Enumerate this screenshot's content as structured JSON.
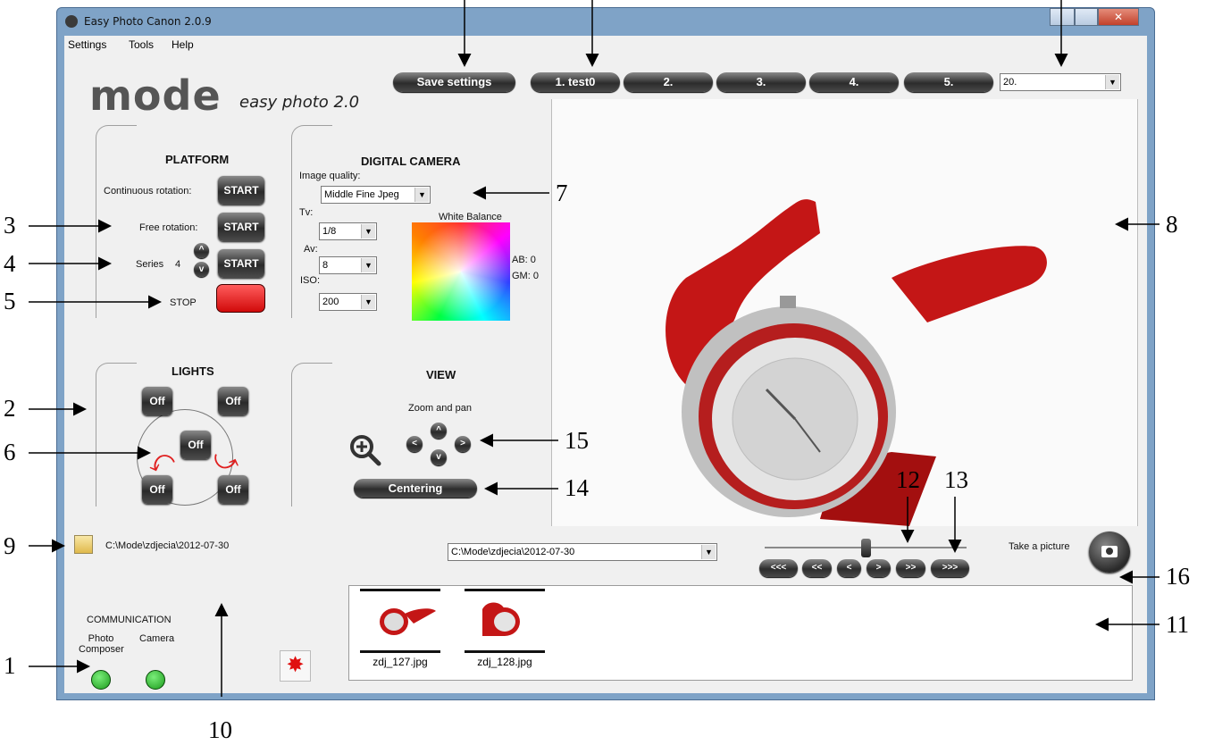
{
  "window": {
    "title": "Easy Photo Canon 2.0.9"
  },
  "menu": {
    "items": [
      "Settings",
      "Tools",
      "Help"
    ]
  },
  "logo": {
    "brand": "mode",
    "tagline": "easy photo 2.0"
  },
  "toolbar": {
    "save_label": "Save settings",
    "presets": [
      "1. test0",
      "2.",
      "3.",
      "4.",
      "5."
    ],
    "preset_select": "20."
  },
  "platform": {
    "title": "PLATFORM",
    "continuous_label": "Continuous rotation:",
    "free_label": "Free rotation:",
    "series_label": "Series",
    "series_value": "4",
    "start_label": "START",
    "stop_label": "STOP",
    "up_label": "^",
    "down_label": "v"
  },
  "camera": {
    "title": "DIGITAL CAMERA",
    "quality_label": "Image quality:",
    "quality_value": "Middle Fine Jpeg",
    "tv_label": "Tv:",
    "tv_value": "1/8",
    "av_label": "Av:",
    "av_value": "8",
    "iso_label": "ISO:",
    "iso_value": "200",
    "wb_label": "White Balance",
    "ab_label": "AB: 0",
    "gm_label": "GM: 0"
  },
  "lights": {
    "title": "LIGHTS",
    "off_label": "Off"
  },
  "view": {
    "title": "VIEW",
    "zoom_label": "Zoom and pan",
    "centering_label": "Centering",
    "left_label": "<",
    "right_label": ">",
    "up_label": "^",
    "down_label": "v"
  },
  "folder": {
    "path": "C:\\Mode\\zdjecia\\2012-07-30"
  },
  "folder_select": {
    "value": "C:\\Mode\\zdjecia\\2012-07-30"
  },
  "nav": {
    "buttons": [
      "<<<",
      "<<",
      "<",
      ">",
      ">>",
      ">>>"
    ],
    "slider_position": 0.5
  },
  "take_picture": {
    "label": "Take a picture"
  },
  "communication": {
    "title": "COMMUNICATION",
    "photo_composer": "Photo\nComposer",
    "camera": "Camera",
    "status_color": "#22b122"
  },
  "thumbnails": [
    {
      "name": "zdj_127.jpg"
    },
    {
      "name": "zdj_128.jpg"
    }
  ],
  "annotations": [
    "1",
    "2",
    "3",
    "4",
    "5",
    "6",
    "7",
    "8",
    "9",
    "10",
    "11",
    "12",
    "13",
    "14",
    "15",
    "16"
  ]
}
